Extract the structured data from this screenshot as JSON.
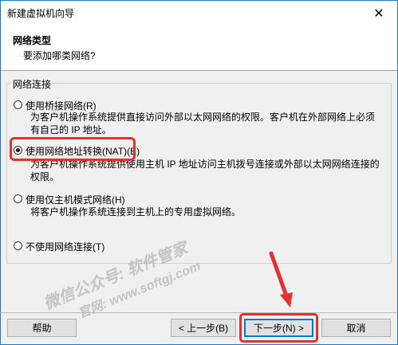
{
  "window": {
    "title": "新建虚拟机向导",
    "close_glyph": "✕"
  },
  "header": {
    "title": "网络类型",
    "subtitle": "要添加哪类网络?"
  },
  "group": {
    "legend": "网络连接"
  },
  "options": [
    {
      "label": "使用桥接网络(R)",
      "desc1": "为客户机操作系统提供直接访问外部以太网网络的权限。客户机在外部网络上必须",
      "desc2": "有自己的 IP 地址。",
      "checked": false
    },
    {
      "label": "使用网络地址转换(NAT)(E)",
      "desc1": "为客户机操作系统提供使用主机 IP 地址访问主机拨号连接或外部以太网网络连接的",
      "desc2": "权限。",
      "checked": true
    },
    {
      "label": "使用仅主机模式网络(H)",
      "desc1": "将客户机操作系统连接到主机上的专用虚拟网络。",
      "checked": false
    },
    {
      "label": "不使用网络连接(T)",
      "checked": false
    }
  ],
  "buttons": {
    "help": "帮助",
    "back": "< 上一步(B)",
    "next": "下一步(N) >",
    "cancel": "取消"
  },
  "watermark": {
    "line1": "微信公众号: 软件管家",
    "line2": "官网: www.softgj.com"
  },
  "colors": {
    "highlight": "#e2322d",
    "accent": "#0078d7"
  }
}
